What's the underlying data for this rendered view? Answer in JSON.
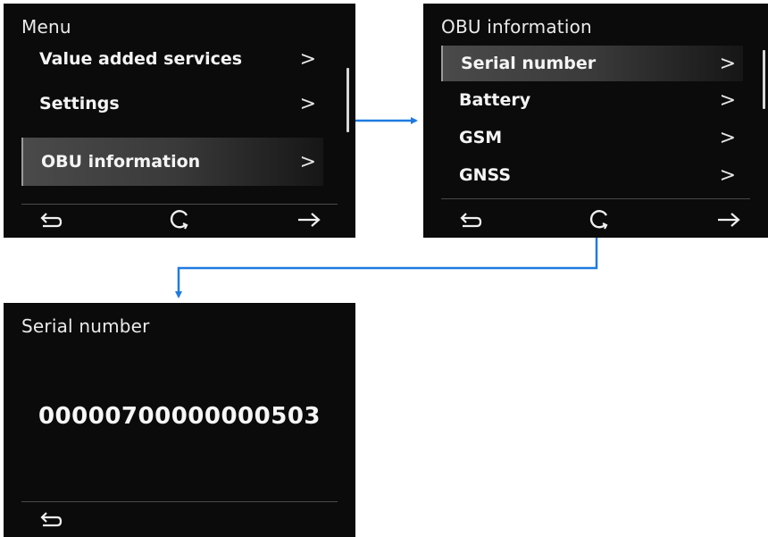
{
  "screen1": {
    "title": "Menu",
    "items": [
      {
        "label": "Value added services",
        "chevron": ">"
      },
      {
        "label": "Settings",
        "chevron": ">"
      },
      {
        "label": "OBU information",
        "chevron": ">",
        "selected": true
      }
    ],
    "nav": {
      "back_icon": "back-arrow-icon",
      "refresh_icon": "rotate-icon",
      "forward_icon": "forward-arrow-icon"
    }
  },
  "screen2": {
    "title": "OBU information",
    "items": [
      {
        "label": "Serial number",
        "chevron": ">",
        "selected": true
      },
      {
        "label": "Battery",
        "chevron": ">"
      },
      {
        "label": "GSM",
        "chevron": ">"
      },
      {
        "label": "GNSS",
        "chevron": ">"
      }
    ],
    "nav": {
      "back_icon": "back-arrow-icon",
      "refresh_icon": "rotate-icon",
      "forward_icon": "forward-arrow-icon"
    }
  },
  "screen3": {
    "title": "Serial number",
    "value": "00000700000000503",
    "nav": {
      "back_icon": "back-arrow-icon"
    }
  },
  "colors": {
    "screen_bg": "#0b0b0b",
    "text": "#f2f2f2",
    "connector": "#1f7ae0",
    "page_bg": "#ffffff"
  }
}
